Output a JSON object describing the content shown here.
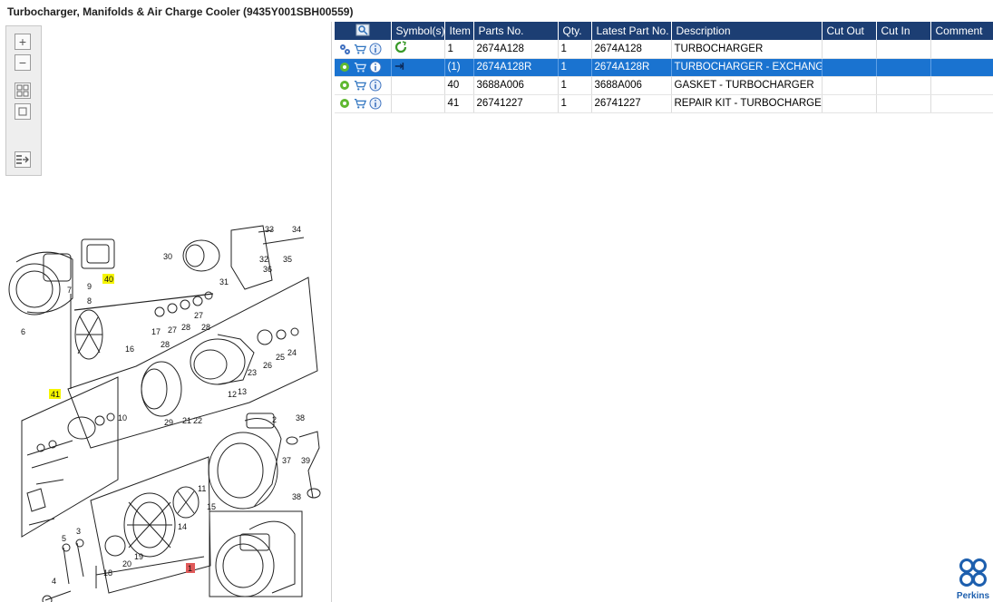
{
  "title": "Turbocharger, Manifolds & Air Charge Cooler (9435Y001SBH00559)",
  "colors": {
    "header_bg": "#1c3e73",
    "selected_row": "#1a73d0",
    "callout_yellow": "#f5f500",
    "callout_red": "#e05a5a"
  },
  "toolbar": {
    "buttons": [
      {
        "name": "zoom-in-icon",
        "glyph": "+"
      },
      {
        "name": "zoom-out-icon",
        "glyph": "−"
      },
      {
        "name": "fit-all-icon",
        "glyph": ""
      },
      {
        "name": "actual-size-icon",
        "glyph": ""
      },
      {
        "name": "toggle-panel-icon",
        "glyph": ""
      }
    ]
  },
  "table": {
    "headers": {
      "icon": "",
      "symbols": "Symbol(s)",
      "item": "Item",
      "parts_no": "Parts No.",
      "qty": "Qty.",
      "latest": "Latest Part No.",
      "description": "Description",
      "cut_out": "Cut Out",
      "cut_in": "Cut In",
      "comment": "Comment"
    },
    "rows": [
      {
        "item": "1",
        "parts_no": "2674A128",
        "qty": "1",
        "latest": "2674A128",
        "description": "TURBOCHARGER",
        "cut_out": "",
        "cut_in": "",
        "comment": "",
        "symbol": "recycle-icon",
        "selected": false
      },
      {
        "item": "(1)",
        "parts_no": "2674A128R",
        "qty": "1",
        "latest": "2674A128R",
        "description": "TURBOCHARGER - EXCHANGE",
        "cut_out": "",
        "cut_in": "",
        "comment": "",
        "symbol": "exchange-icon",
        "selected": true
      },
      {
        "item": "40",
        "parts_no": "3688A006",
        "qty": "1",
        "latest": "3688A006",
        "description": "GASKET - TURBOCHARGER",
        "cut_out": "",
        "cut_in": "",
        "comment": "",
        "symbol": "",
        "selected": false
      },
      {
        "item": "41",
        "parts_no": "26741227",
        "qty": "1",
        "latest": "26741227",
        "description": "REPAIR KIT - TURBOCHARGER",
        "cut_out": "",
        "cut_in": "",
        "comment": "",
        "symbol": "",
        "selected": false
      }
    ]
  },
  "diagram": {
    "callouts": [
      "33",
      "34",
      "30",
      "32",
      "35",
      "36",
      "31",
      "40",
      "7",
      "9",
      "8",
      "6",
      "27",
      "28",
      "27",
      "28",
      "17",
      "27",
      "16",
      "28",
      "41",
      "1",
      "2",
      "10",
      "29",
      "21",
      "22",
      "12",
      "13",
      "23",
      "24",
      "25",
      "26",
      "38",
      "37",
      "39",
      "38",
      "11",
      "15",
      "14",
      "3",
      "5",
      "4",
      "18",
      "19",
      "20"
    ]
  },
  "logo": {
    "text": "Perkins"
  }
}
